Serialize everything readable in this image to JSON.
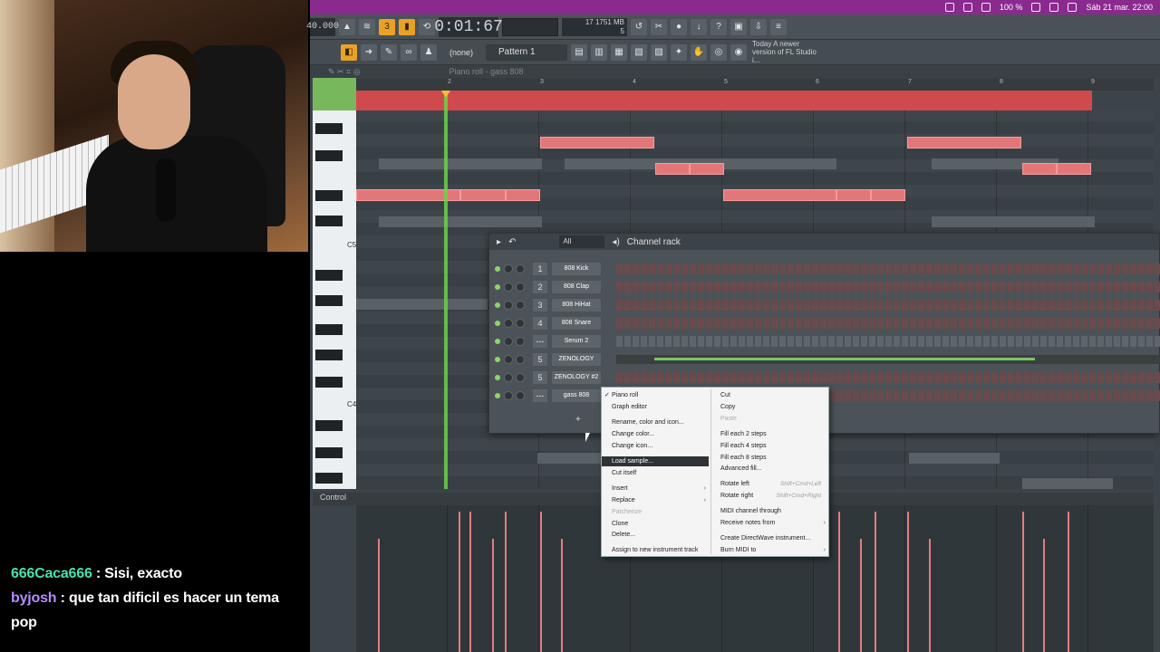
{
  "menubar": {
    "battery": "100 %",
    "datetime": "Sáb 21 mar.  22:00",
    "icons": [
      "ua-icon",
      "la-icon",
      "wifi-icon",
      "search-icon",
      "control-center-icon"
    ]
  },
  "toolbar": {
    "tempo": "40.000",
    "time": "0:01:67",
    "cpu_line1": "17  1751 MB",
    "cpu_line2": "5",
    "none_select": "(none)",
    "pattern_select": "Pattern 1",
    "news": "Today  A newer version of FL Studio i..."
  },
  "piano_roll": {
    "title": "Piano roll - gass 808",
    "ruler": [
      "2",
      "3",
      "4",
      "5",
      "6",
      "7",
      "8",
      "9"
    ],
    "key_labels": [
      "C5",
      "C4"
    ],
    "control_label": "Control"
  },
  "channel_rack": {
    "title": "Channel rack",
    "filter": "All",
    "channels": [
      {
        "num": "1",
        "name": "808 Kick"
      },
      {
        "num": "2",
        "name": "808 Clap"
      },
      {
        "num": "3",
        "name": "808 HiHat"
      },
      {
        "num": "4",
        "name": "808 Snare"
      },
      {
        "num": "---",
        "name": "Serum 2"
      },
      {
        "num": "5",
        "name": "ZENOLOGY"
      },
      {
        "num": "5",
        "name": "ZENOLOGY #2"
      },
      {
        "num": "---",
        "name": "gass 808"
      }
    ],
    "add_button": "+"
  },
  "context_menu": {
    "left": [
      {
        "label": "Piano roll",
        "checked": true
      },
      {
        "label": "Graph editor"
      },
      {
        "label": "Rename, color and icon..."
      },
      {
        "label": "Change color..."
      },
      {
        "label": "Change icon..."
      },
      {
        "label": "Load sample...",
        "highlighted": true
      },
      {
        "label": "Cut itself"
      },
      {
        "label": "Insert",
        "submenu": true
      },
      {
        "label": "Replace",
        "submenu": true
      },
      {
        "label": "Patcherize",
        "disabled": true
      },
      {
        "label": "Clone"
      },
      {
        "label": "Delete..."
      },
      {
        "label": "Assign to new instrument track"
      }
    ],
    "right": [
      {
        "label": "Cut"
      },
      {
        "label": "Copy"
      },
      {
        "label": "Paste",
        "disabled": true
      },
      {
        "label": "Fill each 2 steps"
      },
      {
        "label": "Fill each 4 steps"
      },
      {
        "label": "Fill each 8 steps"
      },
      {
        "label": "Advanced fill..."
      },
      {
        "label": "Rotate left",
        "shortcut": "Shift+Cmd+Left"
      },
      {
        "label": "Rotate right",
        "shortcut": "Shift+Cmd+Right"
      },
      {
        "label": "MIDI channel through"
      },
      {
        "label": "Receive notes from",
        "submenu": true
      },
      {
        "label": "Create DirectWave instrument..."
      },
      {
        "label": "Burn MIDI to",
        "submenu": true
      }
    ]
  },
  "chat": [
    {
      "user": "666Caca666",
      "text": " : Sisi, exacto"
    },
    {
      "user": "byjosh",
      "text": " : que tan dificil es hacer un tema pop"
    }
  ],
  "colors": {
    "accent_orange": "#e9a227",
    "note_red": "#e27779",
    "playhead_green": "#6cd24a",
    "menubar_purple": "#8a2a8e"
  }
}
